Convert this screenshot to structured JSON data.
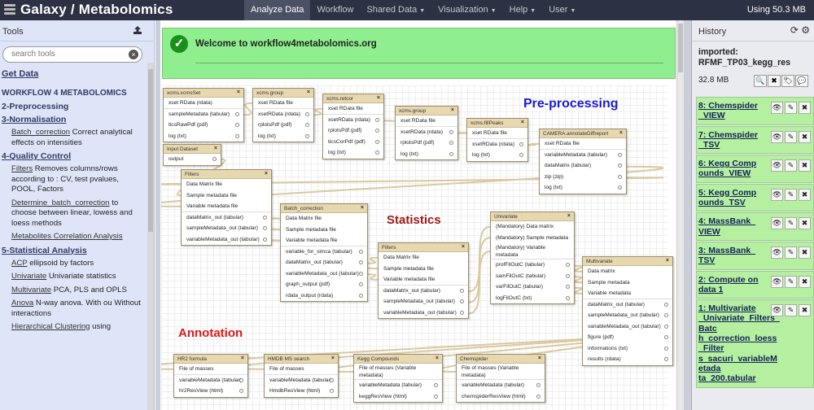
{
  "masthead": {
    "brand": "Galaxy / Metabolomics",
    "nav": [
      {
        "label": "Analyze Data",
        "active": true,
        "caret": false
      },
      {
        "label": "Workflow",
        "active": false,
        "caret": false
      },
      {
        "label": "Shared Data",
        "active": false,
        "caret": true
      },
      {
        "label": "Visualization",
        "active": false,
        "caret": true
      },
      {
        "label": "Help",
        "active": false,
        "caret": true
      },
      {
        "label": "User",
        "active": false,
        "caret": true
      }
    ],
    "quota": "Using 50.3 MB"
  },
  "tools": {
    "title": "Tools",
    "search_placeholder": "search tools",
    "get_data": "Get Data",
    "workflow_header": "WORKFLOW 4 METABOLOMICS",
    "sections": {
      "prep": "2-Preprocessing",
      "norm": "3-Normalisation",
      "norm_tool_name": "Batch_correction",
      "norm_tool_desc": " Correct analytical effects on intensities",
      "qc": "4-Quality Control",
      "qc1_name": "Filters",
      "qc1_desc": " Removes columns/rows according to : CV, test pvalues, POOL, Factors",
      "qc2_name": "Determine_batch_correction",
      "qc2_desc": " to choose between linear, lowess and loess methods",
      "qc3_name": "Metabolites Correlation Analysis",
      "stat": "5-Statistical Analysis",
      "s1_name": "ACP",
      "s1_desc": " ellipsoid by factors",
      "s2_name": "Univariate",
      "s2_desc": " Univariate statistics",
      "s3_name": "Multivariate",
      "s3_desc": " PCA, PLS and OPLS",
      "s4_name": "Anova",
      "s4_desc": " N-way anova. With ou Without interactions",
      "s5_name": "Hierarchical Clustering",
      "s5_desc": " using"
    }
  },
  "message": "Welcome to workflow4metabolomics.org",
  "workflow": {
    "labels": {
      "preprocessing": "Pre-processing",
      "statistics": "Statistics",
      "annotation": "Annotation"
    },
    "nodes": {
      "xcmsset": {
        "title": "xcms.xcmsSet",
        "rows": [
          "xset RData (rdata)",
          "sampleMetadata (tabular)",
          "ticsRawPdf (pdf)",
          "log (txt)"
        ]
      },
      "group1": {
        "title": "xcms.group",
        "rows": [
          "xset RData file",
          "xsetRData (rdata)",
          "rplotsPdf (pdf)",
          "log (txt)"
        ]
      },
      "retcor": {
        "title": "xcms.retcor",
        "rows": [
          "xset RData file",
          "xsetRData (rdata)",
          "rplotsPdf (pdf)",
          "ticsCorPdf (pdf)",
          "log (txt)"
        ]
      },
      "group2": {
        "title": "xcms.group",
        "rows": [
          "xset RData file",
          "xsetRData (rdata)",
          "rplotsPdf (pdf)",
          "log (txt)"
        ]
      },
      "fillpeaks": {
        "title": "xcms.fillPeaks",
        "rows": [
          "xset RData file",
          "xsetRData (rdata)",
          "log (txt)"
        ]
      },
      "camera": {
        "title": "CAMERA.annotateDiffreport",
        "rows": [
          "xset RData file",
          "variableMetadata (tabular)",
          "dataMatrix (tabular)",
          "zip (zip)",
          "log (txt)"
        ]
      },
      "input": {
        "title": "Input Dataset",
        "rows": [
          "output"
        ]
      },
      "filters1": {
        "title": "Filters",
        "rows": [
          "Data Matrix file",
          "Sample metadata file",
          "Variable metadata file",
          "dataMatrix_out (tabular)",
          "sampleMetadata_out (tabular)",
          "variableMetadata_out (tabular)"
        ]
      },
      "batch": {
        "title": "Batch_correction",
        "rows": [
          "Data Matrix file",
          "Sample metadata file",
          "Variable metadata file",
          "variable_for_simca (tabular)",
          "dataMatrix_out (tabular)",
          "variableMetadata_out (tabular)",
          "graph_output (pdf)",
          "rdata_output (rdata)"
        ]
      },
      "filters2": {
        "title": "Filters",
        "rows": [
          "Data Matrix file",
          "Sample metadata file",
          "Variable metadata file",
          "dataMatrix_out (tabular)",
          "sampleMetadata_out (tabular)",
          "variableMetadata_out (tabular)"
        ]
      },
      "univariate": {
        "title": "Univariate",
        "rows": [
          "(Mandatory) Data matrix",
          "(Mandatory) Sample metadata",
          "(Mandatory) Variable metadata",
          "profFilOutC (tabular)",
          "samFilOutC (tabular)",
          "varFilOutC (tabular)",
          "logFilOutC (txt)"
        ]
      },
      "multivariate": {
        "title": "Multivariate",
        "rows": [
          "Data matrix",
          "Sample metadata",
          "Variable metadata",
          "dataMatrix_out (tabular)",
          "sampleMetadata_out (tabular)",
          "variableMetadata_out (tabular)",
          "figure (pdf)",
          "informations (txt)",
          "results (rdata)"
        ]
      },
      "hr2": {
        "title": "HR2 formula",
        "rows": [
          "File of masses",
          "variableMetadata (tabular)",
          "hr2ResView (html)"
        ]
      },
      "hmdb": {
        "title": "HMDB MS search",
        "rows": [
          "File of masses",
          "variableMetadata (tabular)",
          "HmdbResView (html)"
        ]
      },
      "kegg": {
        "title": "Kegg Compounds",
        "rows": [
          "File of masses (Variable metadata)",
          "variableMetadata (tabular)",
          "keggResView (html)"
        ]
      },
      "chemspider": {
        "title": "Chemspider",
        "rows": [
          "File of masses (Variable metadata)",
          "variableMetadata (tabular)",
          "chemspiderResView (html)"
        ]
      }
    }
  },
  "history": {
    "title": "History",
    "name": "imported: RFMF_TP03_kegg_res",
    "size": "32.8 MB",
    "datasets": [
      "8: Chemspider _VIEW",
      "7: Chemspider _TSV",
      "6: Kegg Comp ounds_VIEW",
      "5: Kegg Comp ounds_TSV",
      "4: MassBank_ VIEW",
      "3: MassBank_ TSV",
      "2: Compute on data 1",
      "1: Multivariate _Univariate_Filters_Batc h_correction_loess_Filter s_sacuri_variableMetada ta_200.tabular"
    ]
  },
  "colors": {
    "masthead": "#2c3143",
    "toolpanel": "#dfe5f9",
    "success": "#8fef8f",
    "dataset_ok": "#b5f0a0",
    "preprocessing_label": "#1a1adb",
    "statistics_label": "#a01818",
    "annotation_label": "#e01818",
    "node_header": "#e8d8b0"
  }
}
